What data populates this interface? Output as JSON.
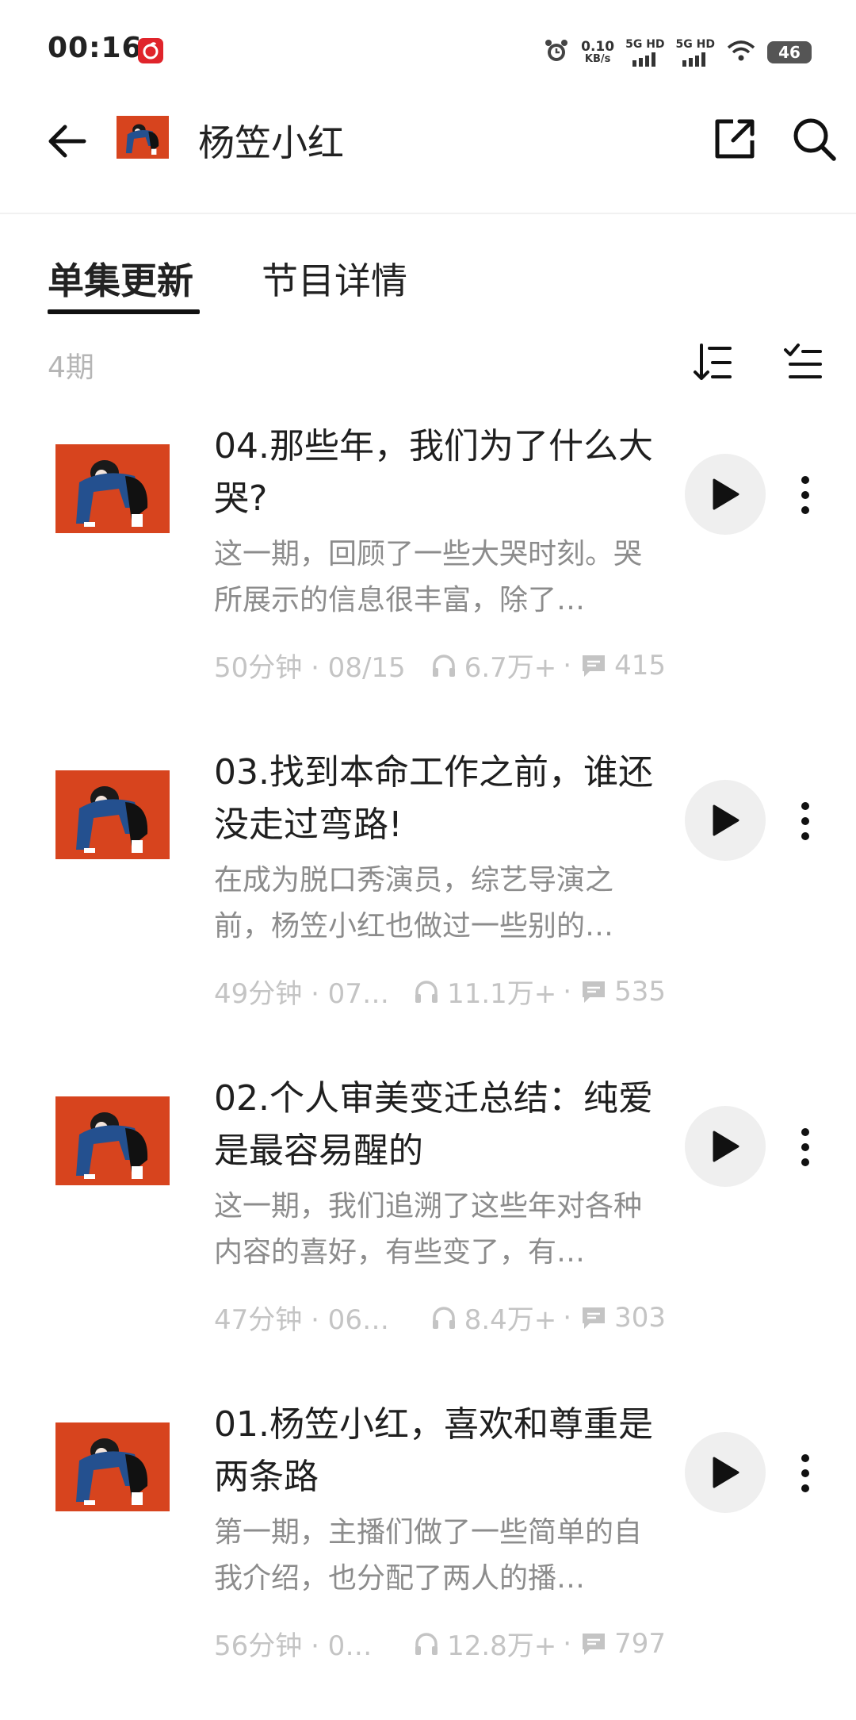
{
  "status_bar": {
    "time": "00:16",
    "speed_value": "0.10",
    "speed_unit": "KB/s",
    "signal_1_label": "5G HD",
    "signal_2_label": "5G HD",
    "battery": "46"
  },
  "header": {
    "title": "杨笠小红"
  },
  "tabs": [
    {
      "label": "单集更新",
      "active": true
    },
    {
      "label": "节目详情",
      "active": false
    }
  ],
  "list": {
    "count_label": "4期"
  },
  "episodes": [
    {
      "title": "04.那些年，我们为了什么大哭?",
      "description": "这一期，回顾了一些大哭时刻。哭所展示的信息很丰富，除了…",
      "duration_date": "50分钟 · 08/15",
      "plays": "6.7万+",
      "comments": "415"
    },
    {
      "title": "03.找到本命工作之前，谁还没走过弯路!",
      "description": "在成为脱口秀演员，综艺导演之前，杨笠小红也做过一些别的…",
      "duration_date": "49分钟 · 07…",
      "plays": "11.1万+",
      "comments": "535"
    },
    {
      "title": "02.个人审美变迁总结：纯爱是最容易醒的",
      "description": "这一期，我们追溯了这些年对各种内容的喜好，有些变了，有…",
      "duration_date": "47分钟 · 06…",
      "plays": "8.4万+",
      "comments": "303"
    },
    {
      "title": "01.杨笠小红，喜欢和尊重是两条路",
      "description": "第一期，主播们做了一些简单的自我介绍，也分配了两人的播…",
      "duration_date": "56分钟 · 0…",
      "plays": "12.8万+",
      "comments": "797"
    }
  ],
  "colors": {
    "cover_bg": "#d7441e",
    "app_icon": "#e0242b",
    "meta_gray": "#c4c4c4"
  }
}
